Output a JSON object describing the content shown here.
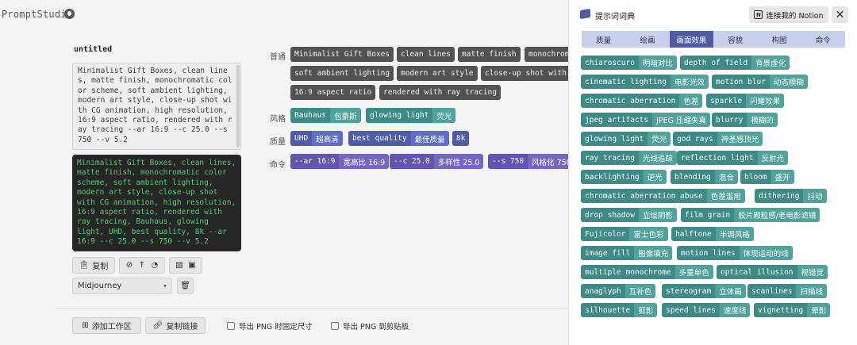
{
  "app": {
    "title": "PromptStudio"
  },
  "doc": {
    "title": "untitled"
  },
  "prompt_input": "Minimalist Gift Boxes, clean lines, matte finish, monochromatic color scheme, soft ambient lighting, modern art style, close-up shot with CG animation, high resolution, 16:9 aspect ratio, rendered with ray tracing --ar 16:9 --c 25.0 --s 750 --v 5.2",
  "prompt_output": "Minimalist Gift Boxes, clean lines, matte finish, monochromatic color scheme, soft ambient lighting, modern art style, close-up shot with CG animation, high resolution, 16:9 aspect ratio, rendered with ray tracing, Bauhaus, glowing light, UHD, best quality, 8k --ar 16:9 --c 25.0 --s 750 --v 5.2",
  "actions": {
    "copy": "复制",
    "model": "Midjourney",
    "add_workspace": "添加工作区",
    "copy_link": "复制链接",
    "export_fixed": "导出 PNG 时固定尺寸",
    "export_clipboard": "导出 PNG 到剪贴板"
  },
  "groups": {
    "normal": {
      "label": "普通",
      "tags": [
        "Minimalist Gift Boxes",
        "clean lines",
        "matte finish",
        "monochrom",
        "soft ambient lighting",
        "modern art style",
        "close-up shot with",
        "16:9 aspect ratio",
        "rendered with ray tracing"
      ]
    },
    "style": {
      "label": "风格",
      "tags": [
        {
          "en": "Bauhaus",
          "zh": "包豪斯"
        },
        {
          "en": "glowing light",
          "zh": "荧光"
        }
      ]
    },
    "quality": {
      "label": "质量",
      "tags": [
        {
          "en": "UHD",
          "zh": "超高清"
        },
        {
          "en": "best quality",
          "zh": "最佳质量"
        },
        {
          "en": "8k",
          "zh": ""
        }
      ]
    },
    "command": {
      "label": "命令",
      "tags": [
        {
          "en": "--ar 16:9",
          "zh": "宽高比 16:9"
        },
        {
          "en": "--c 25.0",
          "zh": "多样性 25.0"
        },
        {
          "en": "--s 750",
          "zh": "风格化 750"
        }
      ]
    }
  },
  "dictionary": {
    "title": "提示词词典",
    "notion_button": "连接我的 Notion",
    "tabs": [
      "质量",
      "绘画",
      "画面效果",
      "容貌",
      "构图",
      "命令"
    ],
    "active_tab": "画面效果",
    "tags": [
      {
        "en": "chiaroscuro",
        "zh": "明暗对比"
      },
      {
        "en": "depth of field",
        "zh": "背景虚化"
      },
      {
        "en": "cinematic lighting",
        "zh": "电影光效"
      },
      {
        "en": "motion blur",
        "zh": "动态模糊"
      },
      {
        "en": "chromatic aberration",
        "zh": "色差"
      },
      {
        "en": "sparkle",
        "zh": "闪耀效果"
      },
      {
        "en": "jpeg artifacts",
        "zh": "JPEG 压缩失真"
      },
      {
        "en": "blurry",
        "zh": "模糊的"
      },
      {
        "en": "glowing light",
        "zh": "荧光"
      },
      {
        "en": "god rays",
        "zh": "神圣感顶光"
      },
      {
        "en": "ray tracing",
        "zh": "光线追踪"
      },
      {
        "en": "reflection light",
        "zh": "反射光"
      },
      {
        "en": "backlighting",
        "zh": "逆光"
      },
      {
        "en": "blending",
        "zh": "混合"
      },
      {
        "en": "bloom",
        "zh": "盛开"
      },
      {
        "en": "chromatic aberration abuse",
        "zh": "色差滥用"
      },
      {
        "en": "dithering",
        "zh": "抖动"
      },
      {
        "en": "drop shadow",
        "zh": "立绘阴影"
      },
      {
        "en": "film grain",
        "zh": "胶片颗粒感/老电影滤镜"
      },
      {
        "en": "Fujicolor",
        "zh": "富士色彩"
      },
      {
        "en": "halftone",
        "zh": "半调风格"
      },
      {
        "en": "image fill",
        "zh": "图像填充"
      },
      {
        "en": "motion lines",
        "zh": "体现运动的线"
      },
      {
        "en": "multiple monochrome",
        "zh": "多重单色"
      },
      {
        "en": "optical illusion",
        "zh": "视错觉"
      },
      {
        "en": "anaglyph",
        "zh": "互补色"
      },
      {
        "en": "stereogram",
        "zh": "立体画"
      },
      {
        "en": "scanlines",
        "zh": "扫描线"
      },
      {
        "en": "silhouette",
        "zh": "剪影"
      },
      {
        "en": "speed lines",
        "zh": "速度线"
      },
      {
        "en": "vignetting",
        "zh": "晕影"
      }
    ]
  },
  "colors": {
    "accent": "#4e5ba6",
    "teal": "#3d8b86",
    "purple": "#6155ad",
    "terminal_green": "#4ccc6c"
  }
}
